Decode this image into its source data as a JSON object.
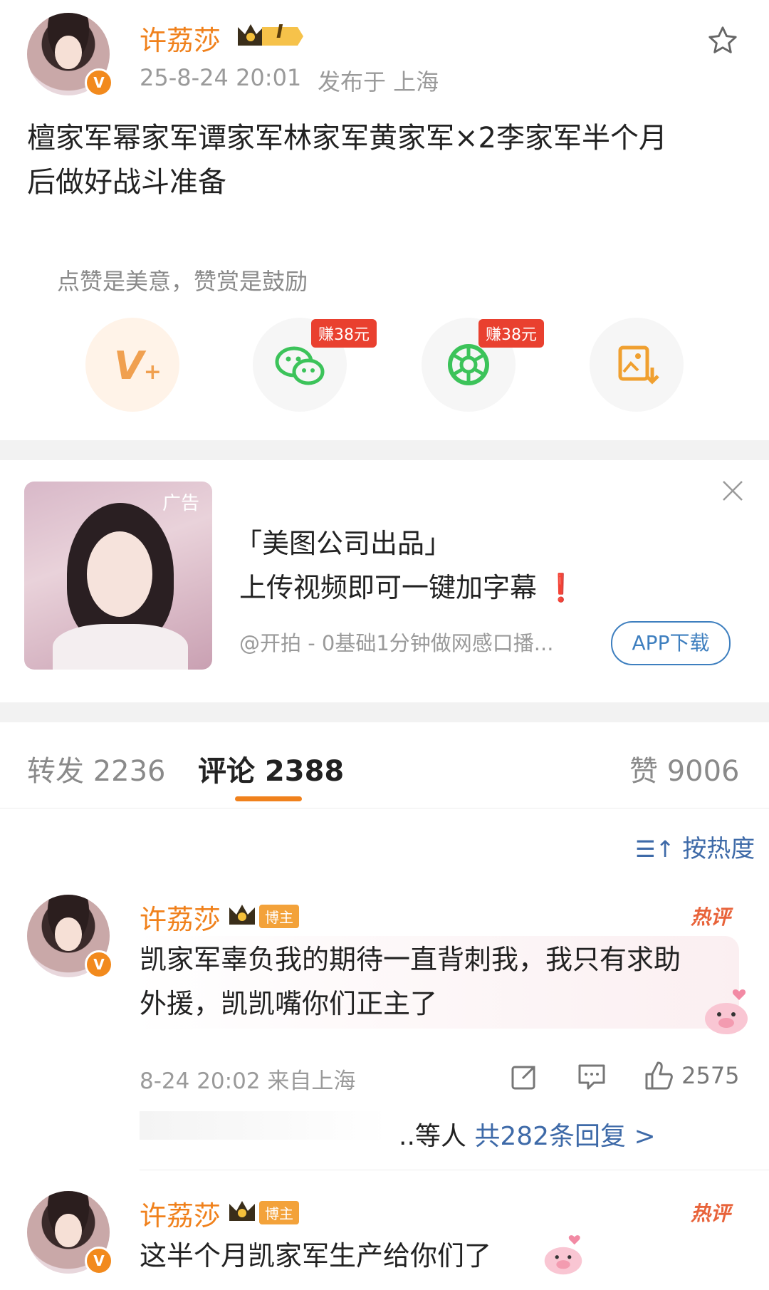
{
  "post": {
    "username": "许荔莎",
    "level_badge": "I",
    "time": "25-8-24 20:01",
    "location": "发布于 上海",
    "content": "檀家军幂家军谭家军林家军黄家军×2李家军半个月后做好战斗准备",
    "content_line1": "檀家军幂家军谭家军林家军黄家军×2李家军半个月",
    "content_line2": "后做好战斗准备"
  },
  "reward": {
    "hint": "点赞是美意，赞赏是鼓励",
    "actions": [
      {
        "name": "vplus",
        "icon": "v-plus-icon"
      },
      {
        "name": "wechat",
        "icon": "wechat-icon",
        "earn": "赚38元"
      },
      {
        "name": "moments",
        "icon": "moments-icon",
        "earn": "赚38元"
      },
      {
        "name": "save-image",
        "icon": "save-image-icon"
      }
    ]
  },
  "ad": {
    "tag": "广告",
    "title": "「美图公司出品」",
    "subtitle": "上传视频即可一键加字幕",
    "exclaim": "❗",
    "source": "@开拍 - 0基础1分钟做网感口播...",
    "cta": "APP下载"
  },
  "tabs": {
    "repost": "转发 2236",
    "comment": "评论 2388",
    "like": "赞 9006"
  },
  "sort": "按热度",
  "comments": [
    {
      "username": "许荔莎",
      "badge": "博主",
      "hot": "热评",
      "line1": "凯家军辜负我的期待一直背刺我，我只有求助",
      "line2": "外援，凯凯嘴你们正主了",
      "time": "8-24 20:02 来自上海",
      "likes": "2575",
      "replies_prefix": "..等人",
      "replies_link": "共282条回复 >"
    },
    {
      "username": "许荔莎",
      "badge": "博主",
      "hot": "热评",
      "line1": "这半个月凯家军生产给你们了"
    }
  ],
  "colors": {
    "username": "#f0811c",
    "earn_badge": "#e9402f",
    "link": "#3e6aa8",
    "accent_underline": "#f0811c"
  }
}
